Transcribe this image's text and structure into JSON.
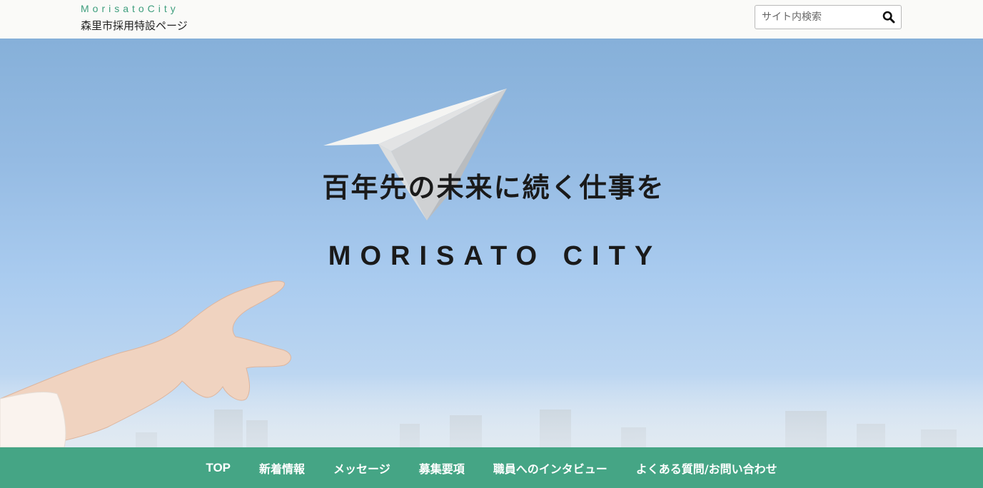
{
  "header": {
    "brand_en": "MorisatoCity",
    "brand_ja": "森里市採用特設ページ"
  },
  "search": {
    "placeholder": "サイト内検索",
    "icon": "search-icon"
  },
  "hero": {
    "catchphrase": "百年先の未来に続く仕事を",
    "city_name": "MORISATO CITY"
  },
  "nav": {
    "items": [
      {
        "label": "TOP"
      },
      {
        "label": "新着情報"
      },
      {
        "label": "メッセージ"
      },
      {
        "label": "募集要項"
      },
      {
        "label": "職員へのインタビュー"
      },
      {
        "label": "よくある質問/お問い合わせ"
      }
    ]
  },
  "colors": {
    "accent": "#45a585",
    "brand_text": "#3e9e7d",
    "sky_top": "#86b0d9",
    "sky_bottom": "#cfdeec"
  }
}
